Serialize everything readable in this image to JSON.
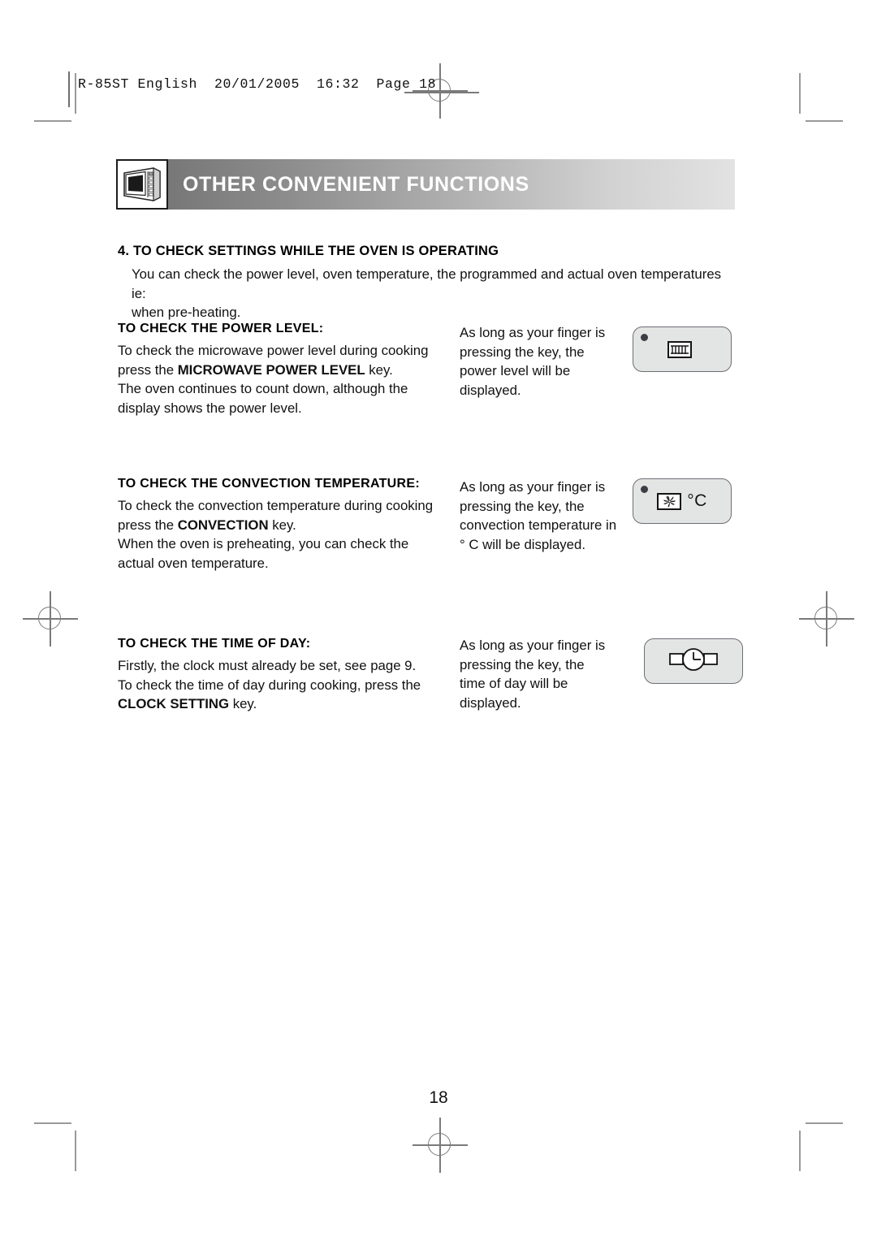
{
  "print_header": {
    "text": "R-85ST English  20/01/2005  16:32  Page 18"
  },
  "banner": {
    "title": "OTHER CONVENIENT FUNCTIONS",
    "icon": "microwave-oven-icon"
  },
  "section": {
    "heading": "4. TO CHECK SETTINGS WHILE THE OVEN IS OPERATING",
    "intro_line1": "You can check the power level, oven temperature, the programmed and actual oven temperatures ie:",
    "intro_line2": "when pre-heating."
  },
  "blocks": [
    {
      "heading": "TO CHECK THE POWER LEVEL:",
      "left_lines": [
        "To check the microwave power level during cooking",
        "press the MICROWAVE POWER LEVEL key.",
        "The oven continues to count down, although the",
        "display shows the power level."
      ],
      "bold_phrase": "MICROWAVE POWER LEVEL",
      "right_lines": [
        "As long as your finger is",
        "pressing the  key, the",
        "power level will be",
        "displayed."
      ],
      "key": {
        "icon": "microwave-power-icon",
        "label": "",
        "has_dot": true
      }
    },
    {
      "heading": "TO CHECK THE CONVECTION TEMPERATURE:",
      "left_lines": [
        "To check the convection temperature during cooking",
        "press the CONVECTION key.",
        "When the oven is preheating, you can check the",
        "actual oven temperature."
      ],
      "bold_phrase": "CONVECTION",
      "right_lines": [
        "As long as your finger is",
        "pressing the  key, the",
        "convection temperature in",
        "° C  will be displayed."
      ],
      "key": {
        "icon": "convection-fan-icon",
        "label": "°C",
        "has_dot": true
      }
    },
    {
      "heading": "TO CHECK THE TIME OF DAY:",
      "left_lines": [
        "Firstly, the clock must already be set, see page 9.",
        "To check the time of day during cooking, press the",
        "CLOCK SETTING key."
      ],
      "bold_phrase": "CLOCK SETTING",
      "right_lines": [
        "As long as your finger is",
        "pressing the  key, the",
        "time of day will be",
        "displayed."
      ],
      "key": {
        "icon": "clock-watch-icon",
        "label": "",
        "has_dot": false
      }
    }
  ],
  "page_number": "18",
  "colors": {
    "banner_start": "#6e6e6e",
    "banner_end": "#e2e2e2",
    "key_fill": "#e3e5e4",
    "key_border": "#6d6d75",
    "crop_mark": "#9a9a9a"
  }
}
